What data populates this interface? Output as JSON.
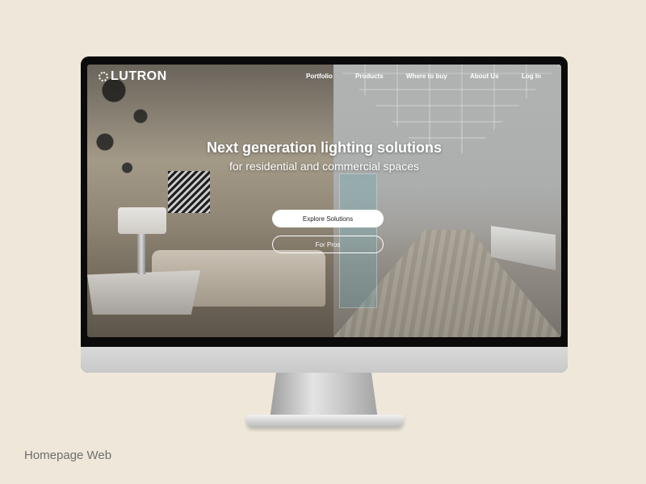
{
  "site": {
    "brand": "LUTRON",
    "nav": [
      "Portfolio",
      "Products",
      "Where to buy",
      "About Us",
      "Log In"
    ]
  },
  "hero": {
    "title": "Next generation lighting solutions",
    "subtitle": "for residential and commercial spaces",
    "primary_button": "Explore Solutions",
    "secondary_button": "For Pros"
  },
  "caption": "Homepage Web",
  "colors": {
    "background": "#efe8da",
    "button_primary_bg": "#ffffff",
    "text_light": "#ffffff"
  },
  "icons": {
    "logo": "lutron-sunburst-icon"
  }
}
